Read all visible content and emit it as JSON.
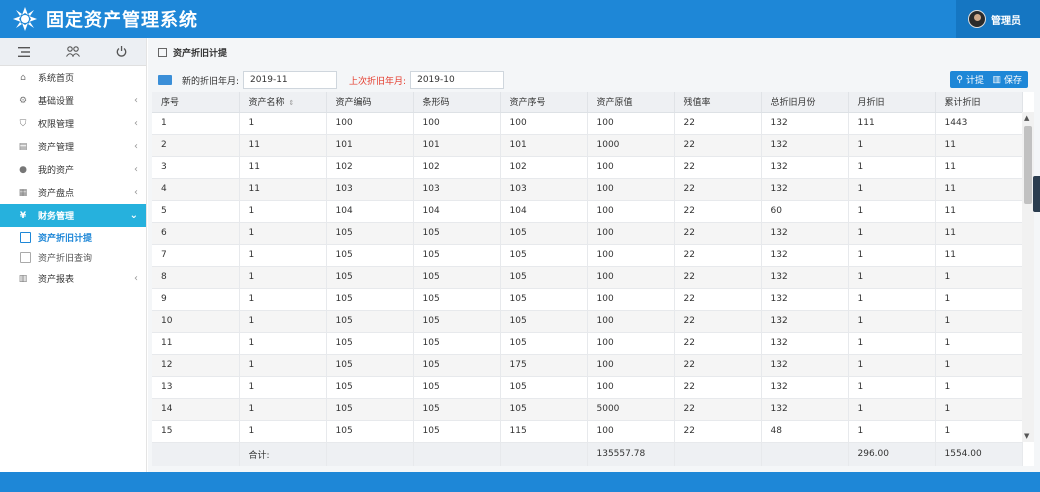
{
  "app": {
    "title": "固定资产管理系统",
    "user": "管理员"
  },
  "sidebar": {
    "items": [
      {
        "label": "系统首页",
        "icon": "home-icon",
        "arrow": false
      },
      {
        "label": "基础设置",
        "icon": "gear-icon",
        "arrow": true
      },
      {
        "label": "权限管理",
        "icon": "shield-icon",
        "arrow": true
      },
      {
        "label": "资产管理",
        "icon": "card-icon",
        "arrow": true
      },
      {
        "label": "我的资产",
        "icon": "user-icon",
        "arrow": true
      },
      {
        "label": "资产盘点",
        "icon": "calculator-icon",
        "arrow": true
      },
      {
        "label": "财务管理",
        "icon": "yen-icon",
        "arrow": true
      },
      {
        "label": "资产报表",
        "icon": "chart-icon",
        "arrow": true
      }
    ],
    "submenu": [
      {
        "label": "资产折旧计提"
      },
      {
        "label": "资产折旧查询"
      }
    ]
  },
  "main": {
    "breadcrumb": "资产折旧计提",
    "filter": {
      "new_label": "新的折旧年月:",
      "new_value": "2019-11",
      "last_label": "上次折旧年月:",
      "last_value": "2019-10",
      "calc_button": "计提",
      "save_button": "保存"
    },
    "table": {
      "columns": [
        "序号",
        "资产名称",
        "资产编码",
        "条形码",
        "资产序号",
        "资产原值",
        "残值率",
        "总折旧月份",
        "月折旧",
        "累计折旧"
      ],
      "rows": [
        [
          "1",
          "1",
          "100",
          "100",
          "100",
          "100",
          "22",
          "132",
          "111",
          "1443"
        ],
        [
          "2",
          "11",
          "101",
          "101",
          "101",
          "1000",
          "22",
          "132",
          "1",
          "11"
        ],
        [
          "3",
          "11",
          "102",
          "102",
          "102",
          "100",
          "22",
          "132",
          "1",
          "11"
        ],
        [
          "4",
          "11",
          "103",
          "103",
          "103",
          "100",
          "22",
          "132",
          "1",
          "11"
        ],
        [
          "5",
          "1",
          "104",
          "104",
          "104",
          "100",
          "22",
          "60",
          "1",
          "11"
        ],
        [
          "6",
          "1",
          "105",
          "105",
          "105",
          "100",
          "22",
          "132",
          "1",
          "11"
        ],
        [
          "7",
          "1",
          "105",
          "105",
          "105",
          "100",
          "22",
          "132",
          "1",
          "11"
        ],
        [
          "8",
          "1",
          "105",
          "105",
          "105",
          "100",
          "22",
          "132",
          "1",
          "1"
        ],
        [
          "9",
          "1",
          "105",
          "105",
          "105",
          "100",
          "22",
          "132",
          "1",
          "1"
        ],
        [
          "10",
          "1",
          "105",
          "105",
          "105",
          "100",
          "22",
          "132",
          "1",
          "1"
        ],
        [
          "11",
          "1",
          "105",
          "105",
          "105",
          "100",
          "22",
          "132",
          "1",
          "1"
        ],
        [
          "12",
          "1",
          "105",
          "105",
          "175",
          "100",
          "22",
          "132",
          "1",
          "1"
        ],
        [
          "13",
          "1",
          "105",
          "105",
          "105",
          "100",
          "22",
          "132",
          "1",
          "1"
        ],
        [
          "14",
          "1",
          "105",
          "105",
          "105",
          "5000",
          "22",
          "132",
          "1",
          "1"
        ],
        [
          "15",
          "1",
          "105",
          "105",
          "115",
          "100",
          "22",
          "48",
          "1",
          "1"
        ]
      ],
      "total": {
        "label": "合计:",
        "original": "135557.78",
        "monthly": "296.00",
        "accumulated": "1554.00"
      }
    }
  },
  "colors": {
    "brand": "#1e87d7",
    "active": "#26b1dd",
    "red_label": "#e53b2c"
  }
}
